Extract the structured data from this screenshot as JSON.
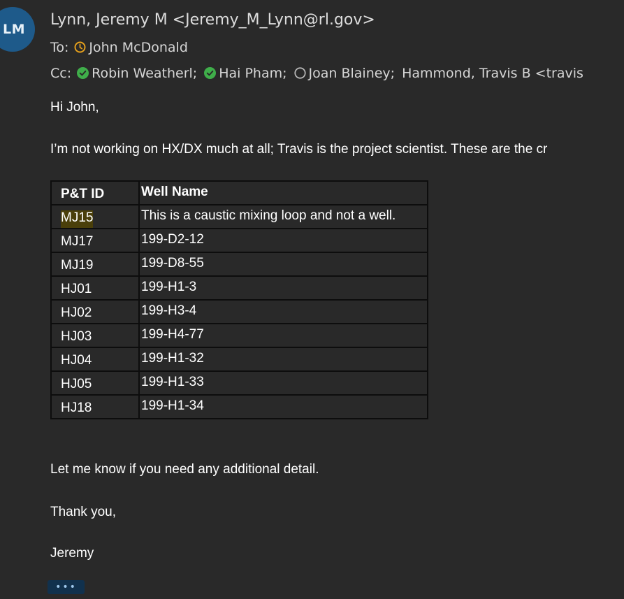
{
  "sender": {
    "initials": "LM",
    "display": "Lynn, Jeremy M <Jeremy_M_Lynn@rl.gov>"
  },
  "to": {
    "label": "To:",
    "recipients": [
      {
        "name": "John McDonald",
        "status": "away"
      }
    ]
  },
  "cc": {
    "label": "Cc:",
    "recipients": [
      {
        "name": "Robin Weatherl;",
        "status": "available"
      },
      {
        "name": "Hai Pham;",
        "status": "available"
      },
      {
        "name": "Joan Blainey;",
        "status": "offline"
      },
      {
        "name": "Hammond, Travis B <travis",
        "status": "none"
      }
    ]
  },
  "colors": {
    "background": "#292929",
    "avatar": "#1e5a8a",
    "available": "#3fae4a",
    "away": "#e8a21c",
    "highlight": "#4a3f0a"
  },
  "message": {
    "greeting": "Hi John,",
    "intro": "I’m not working on HX/DX much at all; Travis is the project scientist. These are the cr",
    "table": {
      "headers": [
        "P&T ID",
        "Well Name"
      ],
      "rows": [
        [
          "MJ15",
          "This is a caustic mixing loop and not a well."
        ],
        [
          "MJ17",
          "199-D2-12"
        ],
        [
          "MJ19",
          "199-D8-55"
        ],
        [
          "HJ01",
          "199-H1-3"
        ],
        [
          "HJ02",
          "199-H3-4"
        ],
        [
          "HJ03",
          "199-H4-77"
        ],
        [
          "HJ04",
          "199-H1-32"
        ],
        [
          "HJ05",
          "199-H1-33"
        ],
        [
          "HJ18",
          "199-H1-34"
        ]
      ]
    },
    "closing": "Let me know if you need any additional detail.",
    "thanks": "Thank you,",
    "signature": "Jeremy"
  },
  "more_button": "•••"
}
